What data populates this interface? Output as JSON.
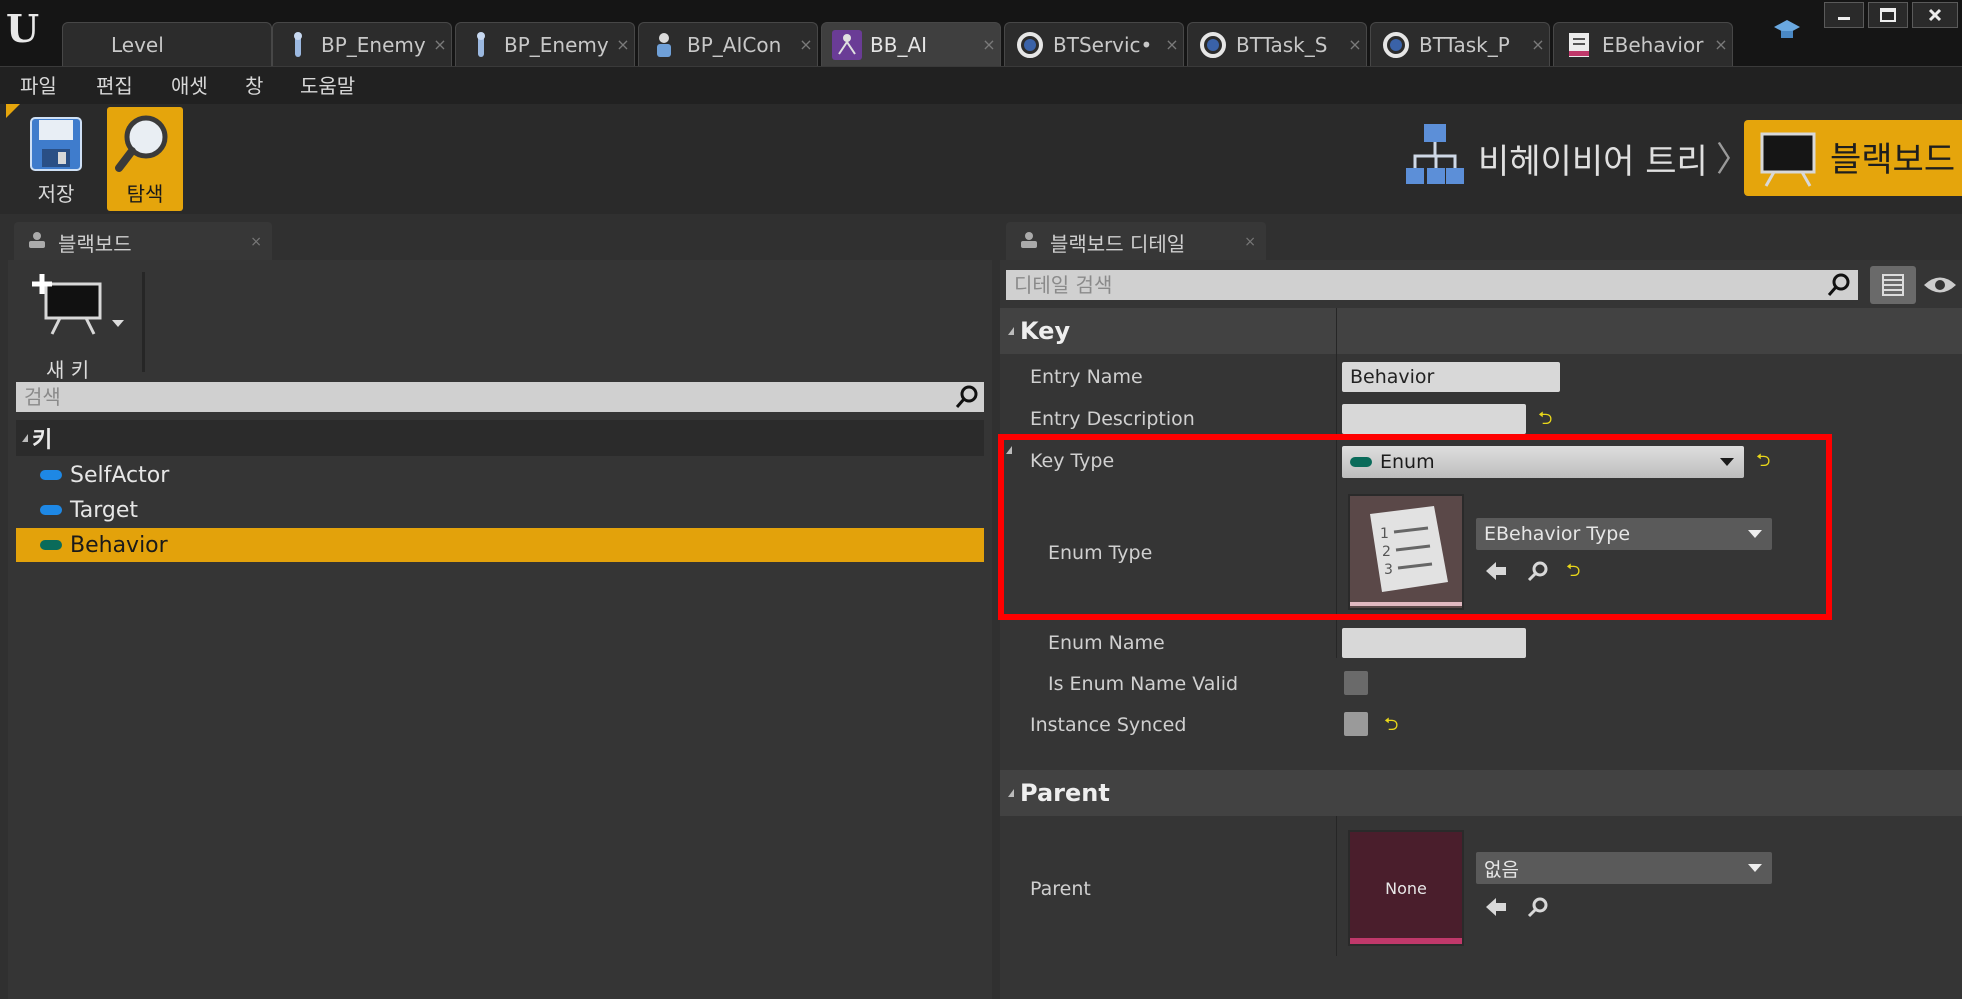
{
  "window": {
    "tabs": [
      {
        "label": "Level",
        "icon": "level"
      },
      {
        "label": "BP_Enemy",
        "icon": "character-icon"
      },
      {
        "label": "BP_Enemy",
        "icon": "character-icon"
      },
      {
        "label": "BP_AICon",
        "icon": "ai-controller-icon"
      },
      {
        "label": "BB_AI",
        "icon": "blackboard-asset-icon"
      },
      {
        "label": "BTServic•",
        "icon": "service-icon"
      },
      {
        "label": "BTTask_S",
        "icon": "task-icon"
      },
      {
        "label": "BTTask_P",
        "icon": "task-icon"
      },
      {
        "label": "EBehavior",
        "icon": "enum-icon"
      }
    ],
    "tab_close_glyph": "×"
  },
  "menu": [
    "파일",
    "편집",
    "애셋",
    "창",
    "도움말"
  ],
  "toolbar": {
    "save_label": "저장",
    "browse_label": "탐색",
    "breadcrumb_bt": "비헤이비어 트리",
    "breadcrumb_sep": "〉",
    "breadcrumb_bb": "블랙보드"
  },
  "blackboard_panel": {
    "tab_title": "블랙보드",
    "new_key_label": "새 키",
    "search_placeholder": "검색",
    "category": "키",
    "keys": [
      {
        "name": "SelfActor",
        "color": "#1e88e5",
        "selected": false
      },
      {
        "name": "Target",
        "color": "#1e88e5",
        "selected": false
      },
      {
        "name": "Behavior",
        "color": "#0a6b5a",
        "selected": true
      }
    ]
  },
  "details_panel": {
    "tab_title": "블랙보드 디테일",
    "search_placeholder": "디테일 검색",
    "key_section": "Key",
    "entry_name_label": "Entry Name",
    "entry_name_value": "Behavior",
    "entry_description_label": "Entry Description",
    "entry_description_value": "",
    "key_type_label": "Key Type",
    "key_type_value": "Enum",
    "enum_type_label": "Enum Type",
    "enum_type_value": "EBehavior Type",
    "enum_name_label": "Enum Name",
    "enum_name_value": "",
    "is_enum_name_valid_label": "Is Enum Name Valid",
    "instance_synced_label": "Instance Synced",
    "parent_section": "Parent",
    "parent_label": "Parent",
    "parent_thumb_text": "None",
    "parent_value": "없음",
    "reset_glyph": "⮌"
  },
  "colors": {
    "accent": "#e5a50c",
    "highlight_box": "#ff0000",
    "enum_pill": "#0a6b5a",
    "object_pill": "#1e88e5"
  }
}
